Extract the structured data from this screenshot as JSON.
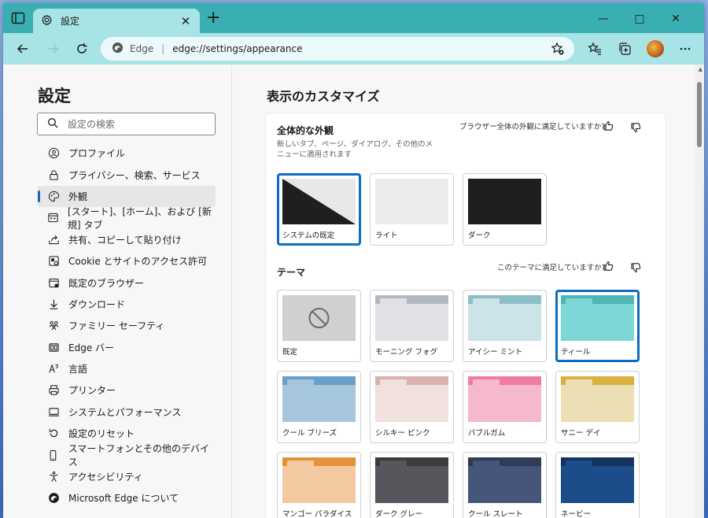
{
  "window": {
    "tab_title": "設定",
    "min": "—",
    "max": "□",
    "close": "✕",
    "new_tab": "+"
  },
  "address": {
    "brand": "Edge",
    "url": "edge://settings/appearance"
  },
  "sidebar": {
    "title": "設定",
    "search_placeholder": "設定の検索",
    "items": [
      {
        "label": "プロファイル",
        "icon": "profile-icon"
      },
      {
        "label": "プライバシー、検索、サービス",
        "icon": "lock-icon"
      },
      {
        "label": "外観",
        "icon": "palette-icon",
        "active": true
      },
      {
        "label": "[スタート]、[ホーム]、および [新規] タブ",
        "icon": "new-tab-icon"
      },
      {
        "label": "共有、コピーして貼り付け",
        "icon": "share-icon"
      },
      {
        "label": "Cookie とサイトのアクセス許可",
        "icon": "cookie-icon"
      },
      {
        "label": "既定のブラウザー",
        "icon": "browser-icon"
      },
      {
        "label": "ダウンロード",
        "icon": "download-icon"
      },
      {
        "label": "ファミリー セーフティ",
        "icon": "family-icon"
      },
      {
        "label": "Edge バー",
        "icon": "edge-bar-icon"
      },
      {
        "label": "言語",
        "icon": "language-icon"
      },
      {
        "label": "プリンター",
        "icon": "printer-icon"
      },
      {
        "label": "システムとパフォーマンス",
        "icon": "system-icon"
      },
      {
        "label": "設定のリセット",
        "icon": "reset-icon"
      },
      {
        "label": "スマートフォンとその他のデバイス",
        "icon": "phone-icon"
      },
      {
        "label": "アクセシビリティ",
        "icon": "accessibility-icon"
      },
      {
        "label": "Microsoft Edge について",
        "icon": "edge-logo-icon"
      }
    ]
  },
  "main": {
    "title": "表示のカスタマイズ",
    "overall": {
      "title": "全体的な外観",
      "desc": "新しいタブ、ページ、ダイアログ、その他のメニューに適用されます",
      "feedback_question": "ブラウザー全体の外観に満足していますか?",
      "options": [
        {
          "label": "システムの既定",
          "selected": true
        },
        {
          "label": "ライト",
          "selected": false
        },
        {
          "label": "ダーク",
          "selected": false
        }
      ]
    },
    "theme": {
      "title": "テーマ",
      "feedback_question": "このテーマに満足していますか?",
      "options": [
        {
          "label": "既定",
          "tab": "#d0d0d0",
          "body": "#d0d0d0",
          "selected": false,
          "default": true
        },
        {
          "label": "モーニング フォグ",
          "tab": "#b4b8bf",
          "body": "#dfe1e4",
          "selected": false
        },
        {
          "label": "アイシー ミント",
          "tab": "#8cbfc8",
          "body": "#cce4e8",
          "selected": false
        },
        {
          "label": "ティール",
          "tab": "#4fb5b5",
          "body": "#7fd6d6",
          "selected": true
        },
        {
          "label": "クール ブリーズ",
          "tab": "#6b9fc7",
          "body": "#a6c6dd",
          "selected": false
        },
        {
          "label": "シルキー ピンク",
          "tab": "#d9b1ad",
          "body": "#f0e0de",
          "selected": false
        },
        {
          "label": "バブルガム",
          "tab": "#f07ba6",
          "body": "#f6b8cf",
          "selected": false
        },
        {
          "label": "サニー デイ",
          "tab": "#d9b13f",
          "body": "#ecdfb6",
          "selected": false
        },
        {
          "label": "マンゴー パラダイス",
          "tab": "#e5923a",
          "body": "#f2c9a0",
          "selected": false
        },
        {
          "label": "ダーク グレー",
          "tab": "#3c3c40",
          "body": "#56565c",
          "selected": false
        },
        {
          "label": "クール スレート",
          "tab": "#2e3d55",
          "body": "#46567a",
          "selected": false
        },
        {
          "label": "ネービー",
          "tab": "#14345f",
          "body": "#1c4d8a",
          "selected": false
        }
      ]
    }
  },
  "colors": {
    "accent": "#0f6cbd",
    "titlebar": "#3aafb3",
    "toolbar": "#a8e3e6"
  }
}
